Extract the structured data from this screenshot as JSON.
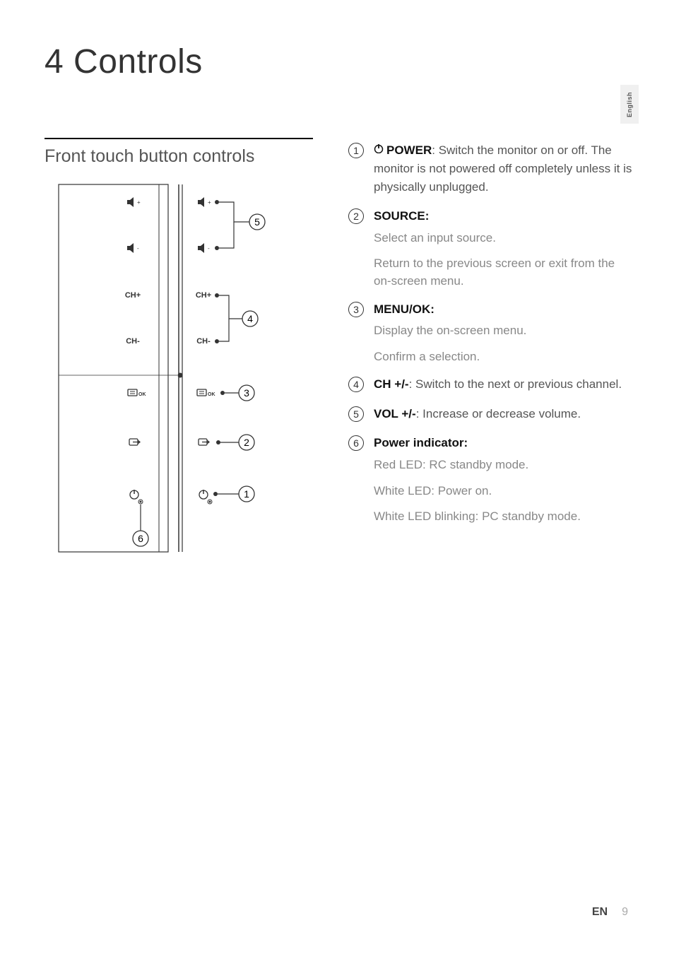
{
  "page_title": "4  Controls",
  "language_tab": "English",
  "section_heading": "Front touch button controls",
  "diagram": {
    "callouts": [
      "1",
      "2",
      "3",
      "4",
      "5",
      "6"
    ],
    "buttons_left": [
      "vol-up",
      "vol-down",
      "ch-up",
      "ch-down",
      "menu-ok",
      "source",
      "power"
    ],
    "button_labels": {
      "ch_up": "CH+",
      "ch_down": "CH-"
    }
  },
  "controls": [
    {
      "num": "1",
      "label_icon": "power-icon",
      "label": "POWER",
      "label_suffix": ":",
      "desc": " Switch the monitor on or off. The monitor is not powered off completely unless it is physically unplugged.",
      "subs": []
    },
    {
      "num": "2",
      "label": "SOURCE",
      "label_suffix": ":",
      "desc": "",
      "subs": [
        "Select an input source.",
        "Return to the previous screen or exit from the on-screen menu."
      ]
    },
    {
      "num": "3",
      "label": "MENU/OK",
      "label_suffix": ":",
      "desc": "",
      "subs": [
        "Display the on-screen menu.",
        "Confirm a selection."
      ]
    },
    {
      "num": "4",
      "label": "CH +/-",
      "label_suffix": ":",
      "desc": " Switch to the next or previous channel.",
      "subs": []
    },
    {
      "num": "5",
      "label": "VOL +/-",
      "label_suffix": ":",
      "desc": " Increase or decrease volume.",
      "subs": []
    },
    {
      "num": "6",
      "label": "Power indicator",
      "label_suffix": ":",
      "desc": "",
      "subs": [
        "Red LED: RC standby mode.",
        "White LED: Power on.",
        "White LED blinking: PC standby mode."
      ]
    }
  ],
  "footer": {
    "lang": "EN",
    "page": "9"
  }
}
